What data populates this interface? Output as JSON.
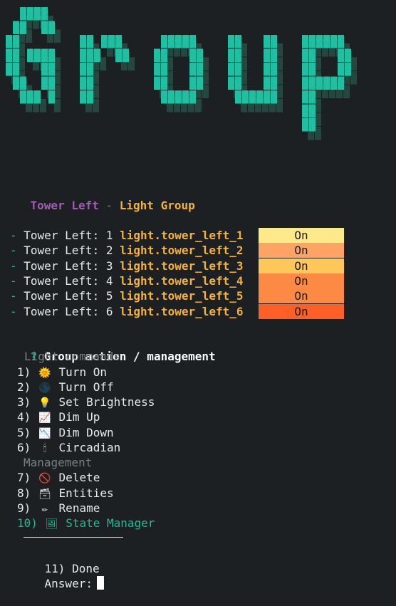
{
  "banner": {
    "text": "Group",
    "face_color": "#20bfa1",
    "shadow_color": "#27463f"
  },
  "header": {
    "left": "Tower Left",
    "sep": " - ",
    "right": "Light Group"
  },
  "lights": [
    {
      "label": "Tower Left: 1",
      "entity": "light.tower_left_1",
      "state": "On",
      "color": "#fde98a"
    },
    {
      "label": "Tower Left: 2",
      "entity": "light.tower_left_2",
      "state": "On",
      "color": "#fca365"
    },
    {
      "label": "Tower Left: 3",
      "entity": "light.tower_left_3",
      "state": "On",
      "color": "#fdc75a"
    },
    {
      "label": "Tower Left: 4",
      "entity": "light.tower_left_4",
      "state": "On",
      "color": "#fd8a44"
    },
    {
      "label": "Tower Left: 5",
      "entity": "light.tower_left_5",
      "state": "On",
      "color": "#fd8a44"
    },
    {
      "label": "Tower Left: 6",
      "entity": "light.tower_left_6",
      "state": "On",
      "color": "#fd5f27"
    }
  ],
  "prompt": {
    "marker": "?",
    "text": "Group action / management"
  },
  "sections": {
    "light": "Light commands",
    "management": "Management"
  },
  "menu": [
    {
      "num": "1)",
      "icon": "sun-icon",
      "glyph": "🌞",
      "label": "Turn On"
    },
    {
      "num": "2)",
      "icon": "moon-icon",
      "glyph": "🌑",
      "label": "Turn Off"
    },
    {
      "num": "3)",
      "icon": "lightbulb-icon",
      "glyph": "💡",
      "label": "Set Brightness"
    },
    {
      "num": "4)",
      "icon": "chart-up-icon",
      "glyph": "📈",
      "label": "Dim Up"
    },
    {
      "num": "5)",
      "icon": "chart-down-icon",
      "glyph": "📉",
      "label": "Dim Down"
    },
    {
      "num": "6)",
      "icon": "candle-icon",
      "glyph": "🕯",
      "label": "Circadian"
    },
    {
      "num": "7)",
      "icon": "no-entry-icon",
      "glyph": "🚫",
      "label": "Delete"
    },
    {
      "num": "8)",
      "icon": "card-box-icon",
      "glyph": "🗃",
      "label": "Entities"
    },
    {
      "num": "9)",
      "icon": "pencil-icon",
      "glyph": "✏",
      "label": "Rename"
    },
    {
      "num": "10)",
      "icon": "framed-picture-icon",
      "glyph": "🖼",
      "label": "State Manager",
      "selected": true
    }
  ],
  "done": {
    "num": "11)",
    "label": "Done"
  },
  "answer": {
    "label": "Answer:"
  }
}
